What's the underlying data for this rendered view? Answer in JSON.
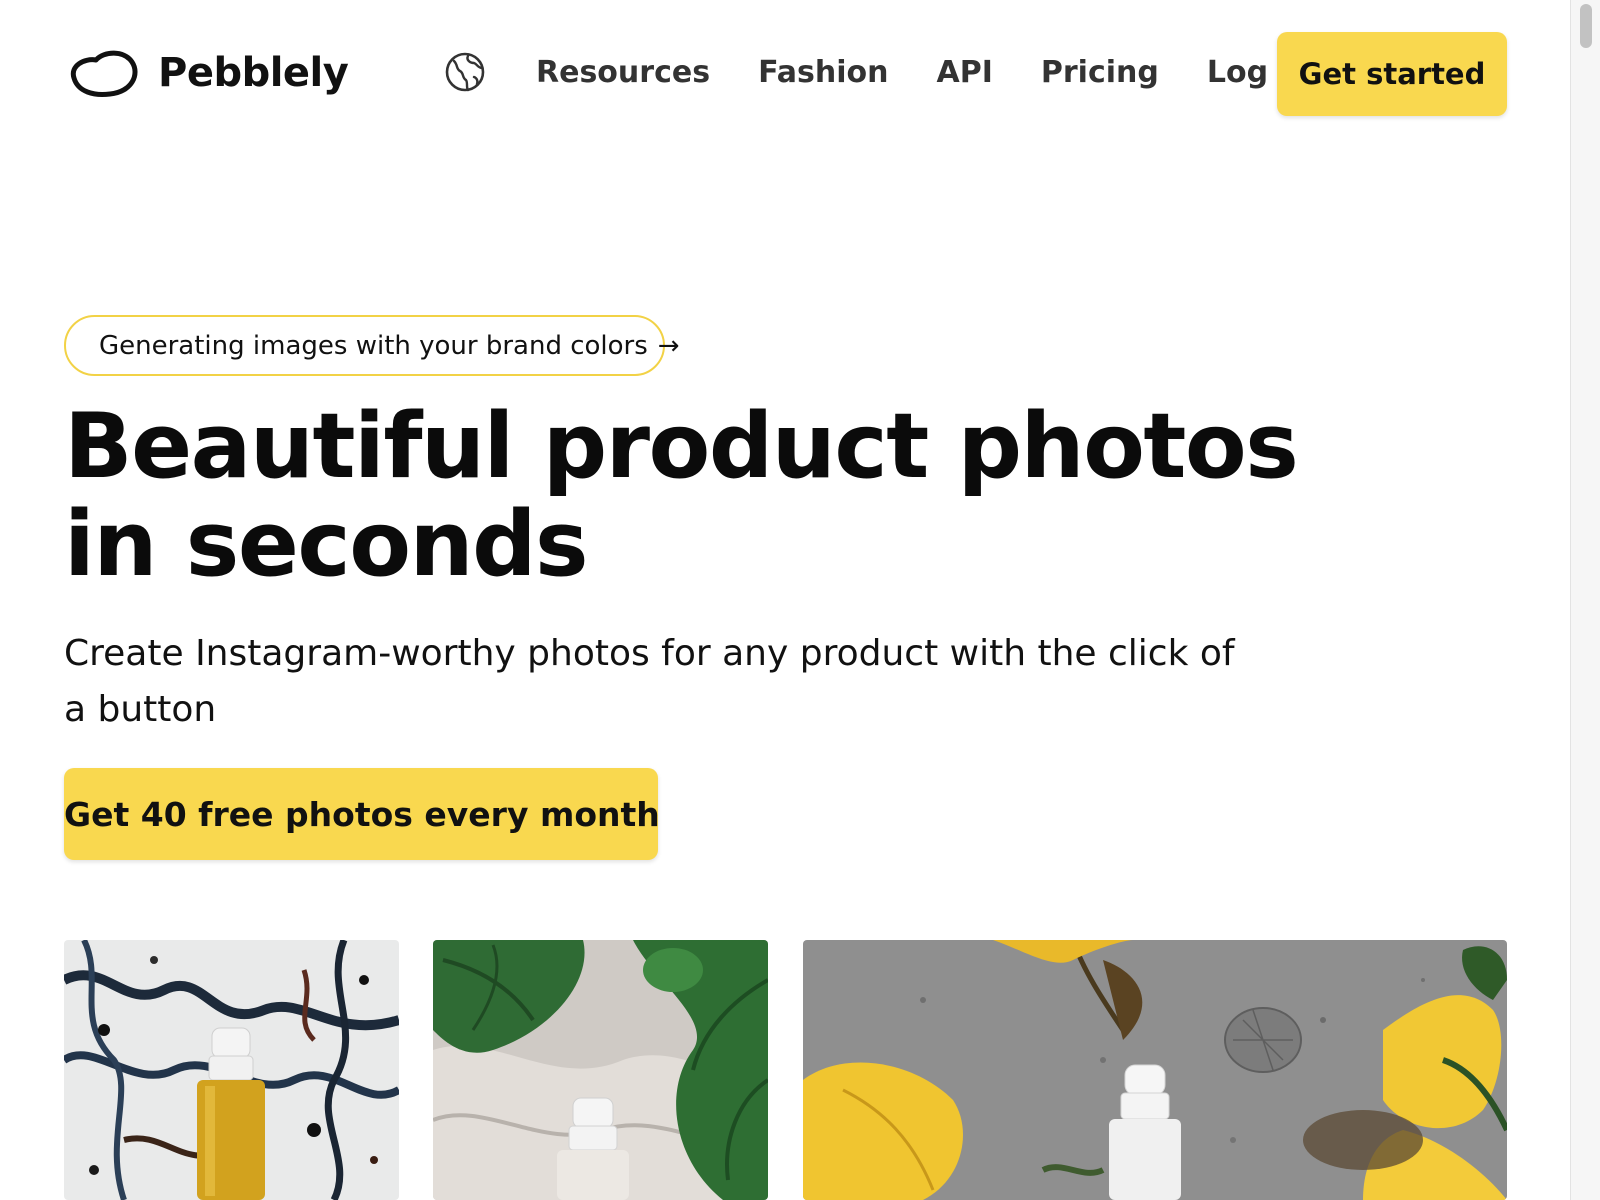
{
  "header": {
    "brand_name": "Pebblely",
    "language_icon": "globe-icon",
    "nav": [
      "Resources",
      "Fashion",
      "API",
      "Pricing",
      "Log in"
    ],
    "cta_label": "Get started"
  },
  "hero": {
    "announcement": "Generating images with your brand colors",
    "announcement_arrow": "→",
    "headline": "Beautiful product photos in seconds",
    "subheadline": "Create Instagram-worthy photos for any product with the click of a button",
    "cta_label": "Get 40 free photos every month"
  },
  "gallery": [
    {
      "name": "dropper-bottle-on-ink-splatter-photo"
    },
    {
      "name": "dropper-bottle-with-monstera-leaves-photo"
    },
    {
      "name": "dropper-bottle-with-yellow-flowers-photo"
    }
  ],
  "colors": {
    "accent": "#f9d84f",
    "pill_border": "#f2d246",
    "text": "#111111"
  }
}
